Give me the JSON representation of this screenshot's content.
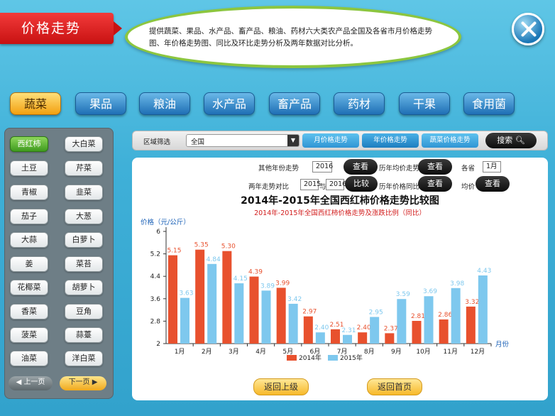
{
  "header": {
    "title": "价格走势",
    "description_line1": "提供蔬菜、果品、水产品、畜产品、粮油、药材六大类农产品全国及各省市月价格走势",
    "description_line2": "图、年价格走势图、同比及环比走势分析及两年数据对比分析。"
  },
  "categories": [
    "蔬菜",
    "果品",
    "粮油",
    "水产品",
    "畜产品",
    "药材",
    "干果",
    "食用菌"
  ],
  "vegetables": [
    "西红柿",
    "大白菜",
    "土豆",
    "芹菜",
    "青椒",
    "韭菜",
    "茄子",
    "大葱",
    "大蒜",
    "白萝卜",
    "姜",
    "菜苔",
    "花椰菜",
    "胡萝卜",
    "香菜",
    "豆角",
    "菠菜",
    "蒜薹",
    "油菜",
    "洋白菜"
  ],
  "pager": {
    "prev": "上一页",
    "next": "下一页"
  },
  "filter": {
    "region_label": "区域筛选",
    "region_value": "全国",
    "tabs": [
      "月价格走势",
      "年价格走势",
      "蔬菜价格走势"
    ],
    "search_label": "搜索"
  },
  "controls": {
    "other_year_label": "其他年份走势",
    "other_year_value": "2016",
    "view_label": "查看",
    "compare_label": "两年走势对比",
    "compare_year1": "2015",
    "compare_and": "与",
    "compare_year2": "2016",
    "compare_button": "比较",
    "yoy_label": "历年均价走势",
    "hist_label": "历年价格同比",
    "province_label": "各省",
    "month_value": "1月",
    "avg_label": "均价"
  },
  "chart_data": {
    "type": "bar",
    "title": "2014年-2015年全国西红柿价格走势比较图",
    "subtitle": "2014年-2015年全国西红柿价格走势及涨跌比例（同比）",
    "ylabel": "价格（元/公斤）",
    "xlabel": "月份",
    "categories": [
      "1月",
      "2月",
      "3月",
      "4月",
      "5月",
      "6月",
      "7月",
      "8月",
      "9月",
      "10月",
      "11月",
      "12月"
    ],
    "yticks": [
      "2",
      "2.8",
      "3.6",
      "4.4",
      "5.2",
      "6"
    ],
    "ylim": [
      2,
      6
    ],
    "series": [
      {
        "name": "2014年",
        "color": "#e8512e",
        "values": [
          5.15,
          5.35,
          5.3,
          4.39,
          3.99,
          2.97,
          2.51,
          2.4,
          2.37,
          2.81,
          2.86,
          3.32
        ]
      },
      {
        "name": "2015年",
        "color": "#7ec8ee",
        "values": [
          3.63,
          4.84,
          4.15,
          3.89,
          3.42,
          2.4,
          2.31,
          2.95,
          3.59,
          3.69,
          3.98,
          4.43
        ]
      }
    ],
    "legend_position": "bottom",
    "grid": false
  },
  "footer": {
    "back_up": "返回上级",
    "back_home": "返回首页"
  }
}
